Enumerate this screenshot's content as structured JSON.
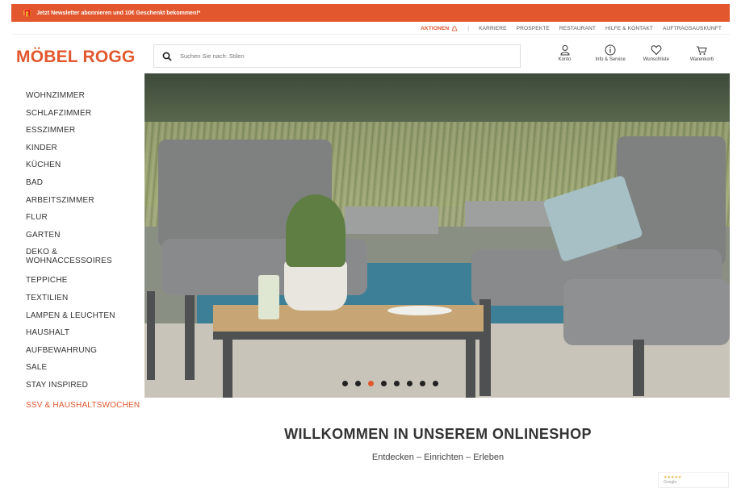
{
  "promo": {
    "text": "Jetzt Newsletter abonnieren und 10€ Geschenkt bekommen!*"
  },
  "topnav": {
    "aktionen": "AKTIONEN",
    "items": [
      "KARRIERE",
      "PROSPEKTE",
      "RESTAURANT",
      "HILFE & KONTAKT",
      "AUFTRAGSAUSKUNFT"
    ]
  },
  "logo": "MÖBEL ROGG",
  "search": {
    "placeholder": "Suchen Sie nach: Stilen"
  },
  "header_icons": [
    {
      "label": "Konto",
      "icon": "user-icon"
    },
    {
      "label": "Info & Service",
      "icon": "info-icon"
    },
    {
      "label": "Wunschliste",
      "icon": "heart-icon"
    },
    {
      "label": "Warenkorb",
      "icon": "cart-icon"
    }
  ],
  "sidebar": {
    "items": [
      "WOHNZIMMER",
      "SCHLAFZIMMER",
      "ESSZIMMER",
      "KINDER",
      "KÜCHEN",
      "BAD",
      "ARBEITSZIMMER",
      "FLUR",
      "GARTEN",
      "DEKO & WOHNACCESSOIRES",
      "TEPPICHE",
      "TEXTILIEN",
      "LAMPEN & LEUCHTEN",
      "HAUSHALT",
      "AUFBEWAHRUNG",
      "SALE",
      "STAY INSPIRED",
      "SSV & HAUSHALTSWOCHEN"
    ]
  },
  "carousel": {
    "dot_count": 8,
    "active_index": 2
  },
  "welcome": {
    "title": "WILLKOMMEN IN UNSEREM ONLINESHOP",
    "tagline": "Entdecken – Einrichten – Erleben"
  },
  "badge": {
    "stars": "★★★★★",
    "source": "Google"
  },
  "colors": {
    "accent": "#e2572e",
    "text": "#333333"
  }
}
